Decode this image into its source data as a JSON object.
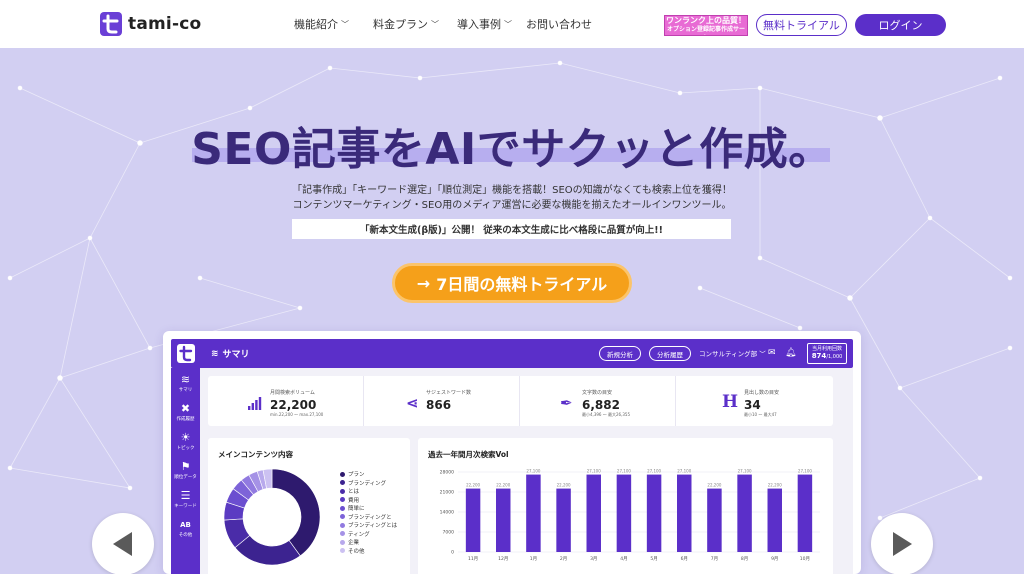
{
  "header": {
    "logo_text": "tami-co",
    "nav": [
      {
        "label": "機能紹介",
        "has_dropdown": true
      },
      {
        "label": "料金プラン",
        "has_dropdown": true
      },
      {
        "label": "導入事例",
        "has_dropdown": true
      },
      {
        "label": "お問い合わせ",
        "has_dropdown": false
      }
    ],
    "banner_line1": "ワンランク上の品質！",
    "banner_line2": "オプション登録記事作成サービス",
    "trial_button": "無料トライアル",
    "login_button": "ログイン",
    "accent_color": "#5b2fc9"
  },
  "hero": {
    "title": "SEO記事をAIでサクッと作成。",
    "subtitle_line1": "「記事作成」「キーワード選定」「順位測定」機能を搭載！SEOの知識がなくても検索上位を獲得！",
    "subtitle_line2": "コンテンツマーケティング・SEO用のメディア運営に必要な機能を揃えたオールインワンツール。",
    "news": "「新本文生成(β版)」公開！ 従来の本文生成に比べ格段に品質が向上!!",
    "cta_label": "7日間の無料トライアル",
    "cta_color": "#f5a01a"
  },
  "app_preview": {
    "page_title": "サマリ",
    "btn_new_analysis": "新規分析",
    "btn_history": "分析履歴",
    "consulting_label": "コンサルティング部",
    "usage_label": "当月利用回数",
    "usage_value": "874",
    "usage_total": "/1,000",
    "sidebar": [
      {
        "label": "サマリ",
        "icon": "layers-icon"
      },
      {
        "label": "作成履歴",
        "icon": "tools-icon"
      },
      {
        "label": "トピック",
        "icon": "bulb-icon"
      },
      {
        "label": "順位データ",
        "icon": "ranking-icon"
      },
      {
        "label": "キーワード",
        "icon": "list-icon"
      },
      {
        "label": "その他",
        "icon": "ab-icon"
      }
    ],
    "stats": [
      {
        "label": "月間検索ボリューム",
        "value": "22,200",
        "note": "min.22,200 〜 max.27,100",
        "icon": "bar-chart-icon"
      },
      {
        "label": "サジェストワード数",
        "value": "866",
        "note": "",
        "icon": "share-icon"
      },
      {
        "label": "文字数の目安",
        "value": "6,882",
        "note": "最小4,396 〜 最大26,355",
        "icon": "pen-icon"
      },
      {
        "label": "見出し数の目安",
        "value": "34",
        "note": "最小10 〜 最大47",
        "icon": "heading-icon"
      }
    ],
    "donut_panel": {
      "title": "メインコンテンツ内容",
      "legend": [
        {
          "label": "プラン",
          "color": "#2e1a6e"
        },
        {
          "label": "ブランディング",
          "color": "#3c2390"
        },
        {
          "label": "とは",
          "color": "#4a2ca8"
        },
        {
          "label": "費用",
          "color": "#5b3bc2"
        },
        {
          "label": "簡単に",
          "color": "#6b4ed0"
        },
        {
          "label": "ブランディングと",
          "color": "#7d63d8"
        },
        {
          "label": "ブランディングとは",
          "color": "#917ae0"
        },
        {
          "label": "ティング",
          "color": "#a592e6"
        },
        {
          "label": "企業",
          "color": "#b8a9ec"
        },
        {
          "label": "その他",
          "color": "#ccc1f2"
        }
      ]
    },
    "bar_panel": {
      "title": "過去一年間月次検索Vol"
    }
  },
  "chart_data": {
    "type": "bar",
    "title": "過去一年間月次検索Vol",
    "categories": [
      "11月",
      "12月",
      "1月",
      "2月",
      "3月",
      "4月",
      "5月",
      "6月",
      "7月",
      "8月",
      "9月",
      "10月"
    ],
    "values": [
      22200,
      22200,
      27100,
      22200,
      27100,
      27100,
      27100,
      27100,
      22200,
      27100,
      22200,
      27100
    ],
    "ylim": [
      0,
      28000
    ],
    "yticks": [
      "0",
      "7000",
      "14000",
      "21000",
      "28000"
    ],
    "bar_color": "#5b2fc9",
    "grid": true
  }
}
